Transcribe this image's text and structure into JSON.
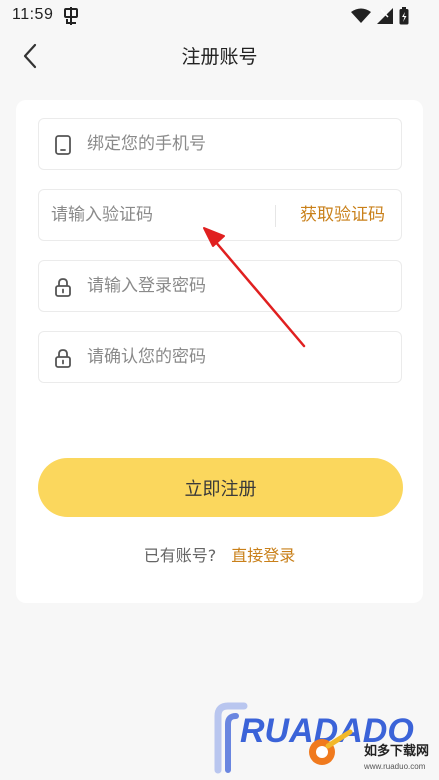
{
  "status_bar": {
    "time": "11:59"
  },
  "header": {
    "title": "注册账号"
  },
  "form": {
    "phone_placeholder": "绑定您的手机号",
    "code_placeholder": "请输入验证码",
    "get_code_label": "获取验证码",
    "password_placeholder": "请输入登录密码",
    "confirm_password_placeholder": "请确认您的密码"
  },
  "actions": {
    "register_label": "立即注册",
    "have_account_text": "已有账号?",
    "login_link_label": "直接登录"
  },
  "watermark": {
    "brand_text": "RUADADO",
    "site_name": "如多下载网",
    "site_url": "www.ruaduo.com"
  },
  "colors": {
    "accent": "#c9801a",
    "button": "#fbd75d",
    "background": "#f7f7f7",
    "card": "#ffffff",
    "annotation": "#e02020"
  }
}
